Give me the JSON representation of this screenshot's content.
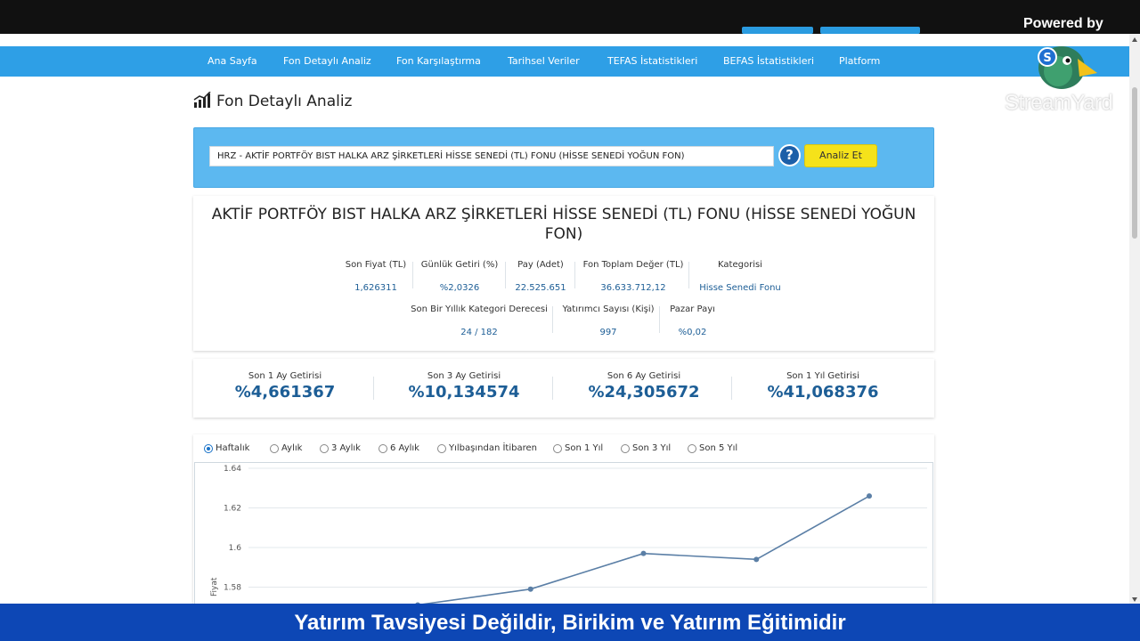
{
  "overlay": {
    "powered_by": "Powered by",
    "brand": "StreamYard",
    "banner": "Yatırım Tavsiyesi Değildir, Birikim ve Yatırım Eğitimidir"
  },
  "nav": {
    "items": [
      "Ana Sayfa",
      "Fon Detaylı Analiz",
      "Fon Karşılaştırma",
      "Tarihsel Veriler",
      "TEFAS İstatistikleri",
      "BEFAS İstatistikleri",
      "Platform"
    ]
  },
  "page": {
    "title": "Fon Detaylı Analiz"
  },
  "search": {
    "value": "HRZ - AKTİF PORTFÖY BIST HALKA ARZ ŞİRKETLERİ HİSSE SENEDİ (TL) FONU (HİSSE SENEDİ YOĞUN FON)",
    "help": "?",
    "button": "Analiz Et"
  },
  "fund": {
    "name": "AKTİF PORTFÖY BIST HALKA ARZ ŞİRKETLERİ HİSSE SENEDİ (TL) FONU (HİSSE SENEDİ YOĞUN FON)",
    "stats_row1": [
      {
        "label": "Son Fiyat (TL)",
        "value": "1,626311"
      },
      {
        "label": "Günlük Getiri (%)",
        "value": "%2,0326"
      },
      {
        "label": "Pay (Adet)",
        "value": "22.525.651"
      },
      {
        "label": "Fon Toplam Değer (TL)",
        "value": "36.633.712,12"
      },
      {
        "label": "Kategorisi",
        "value": "Hisse Senedi Fonu"
      }
    ],
    "stats_row2": [
      {
        "label": "Son Bir Yıllık Kategori Derecesi",
        "value": "24 / 182"
      },
      {
        "label": "Yatırımcı Sayısı (Kişi)",
        "value": "997"
      },
      {
        "label": "Pazar Payı",
        "value": "%0,02"
      }
    ]
  },
  "returns": [
    {
      "label": "Son 1 Ay Getirisi",
      "value": "%4,661367"
    },
    {
      "label": "Son 3 Ay Getirisi",
      "value": "%10,134574"
    },
    {
      "label": "Son 6 Ay Getirisi",
      "value": "%24,305672"
    },
    {
      "label": "Son 1 Yıl Getirisi",
      "value": "%41,068376"
    }
  ],
  "periods": {
    "options": [
      "Haftalık",
      "Aylık",
      "3 Aylık",
      "6 Aylık",
      "Yılbaşından İtibaren",
      "Son 1 Yıl",
      "Son 3 Yıl",
      "Son 5 Yıl"
    ],
    "selected": "Haftalık"
  },
  "chart_data": {
    "type": "line",
    "ylabel": "Fiyat",
    "ylim": [
      1.56,
      1.64
    ],
    "yticks": [
      "1.64",
      "1.62",
      "1.6",
      "1.58"
    ],
    "series": [
      {
        "values": [
          1.571,
          1.579,
          1.597,
          1.594,
          1.626
        ]
      }
    ],
    "line_color": "#5b7fa6",
    "grid": true
  }
}
